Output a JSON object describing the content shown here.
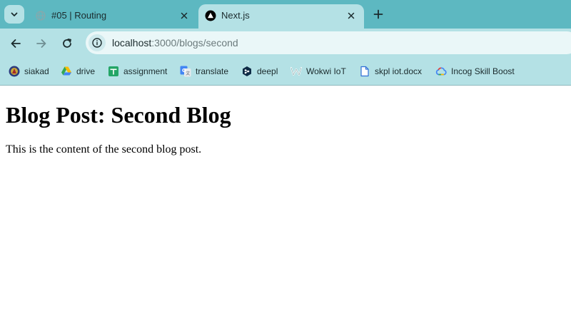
{
  "browser": {
    "tabs": [
      {
        "title": "#05 | Routing",
        "active": false,
        "icon": "loading-globe-icon"
      },
      {
        "title": "Next.js",
        "active": true,
        "icon": "nextjs-icon"
      }
    ],
    "address": {
      "host": "localhost",
      "path": ":3000/blogs/second"
    },
    "bookmarks": [
      {
        "label": "siakad",
        "icon": "university-crest-icon"
      },
      {
        "label": "drive",
        "icon": "google-drive-icon"
      },
      {
        "label": "assignment",
        "icon": "google-sheets-icon"
      },
      {
        "label": "translate",
        "icon": "google-translate-icon"
      },
      {
        "label": "deepl",
        "icon": "deepl-icon"
      },
      {
        "label": "Wokwi IoT",
        "icon": "wokwi-icon"
      },
      {
        "label": "skpl iot.docx",
        "icon": "document-icon"
      },
      {
        "label": "Incog Skill Boost",
        "icon": "google-cloud-icon"
      }
    ],
    "colors": {
      "tabstrip": "#5db8c1",
      "toolbar": "#b4e1e5",
      "omnibox": "#eaf7f8"
    }
  },
  "page": {
    "heading": "Blog Post: Second Blog",
    "body": "This is the content of the second blog post."
  }
}
